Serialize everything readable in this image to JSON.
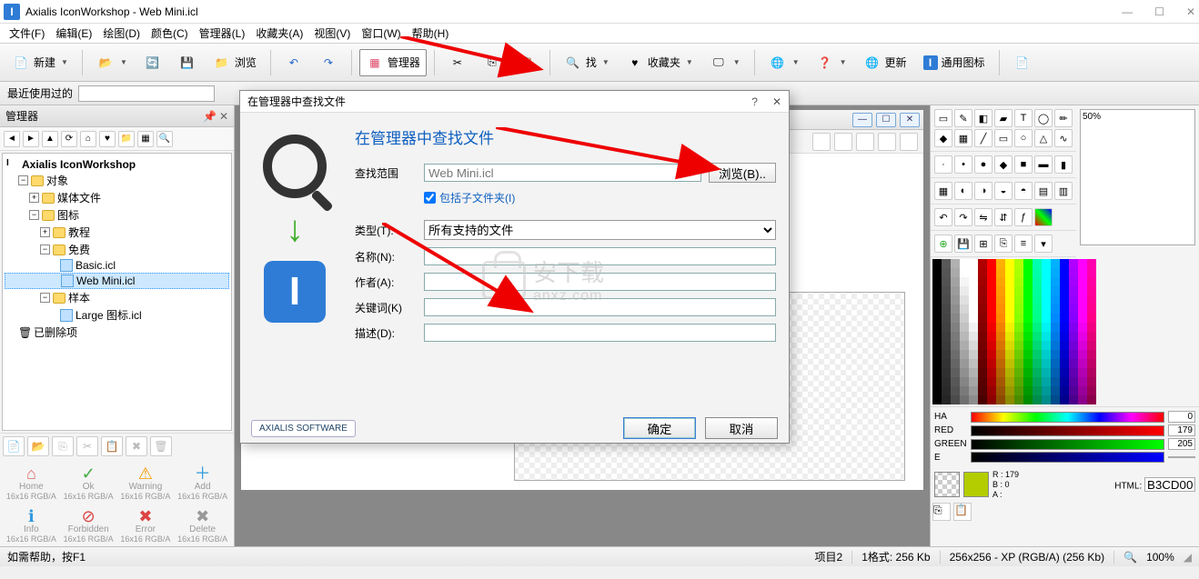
{
  "title": "Axialis IconWorkshop - Web Mini.icl",
  "menu": [
    "文件(F)",
    "编辑(E)",
    "绘图(D)",
    "颜色(C)",
    "管理器(L)",
    "收藏夹(A)",
    "视图(V)",
    "窗口(W)",
    "帮助(H)"
  ],
  "toolbar": {
    "new": "新建",
    "browse": "浏览",
    "manager": "管理器",
    "search": "找",
    "favorites": "收藏夹",
    "update": "更新",
    "general_icons": "通用图标"
  },
  "recent_label": "最近使用过的",
  "sidebar": {
    "header": "管理器",
    "root": "Axialis IconWorkshop",
    "items": [
      "对象",
      "媒体文件",
      "图标",
      "教程",
      "免费",
      "Basic.icl",
      "Web Mini.icl",
      "样本",
      "Large 图标.icl",
      "已删除项"
    ]
  },
  "icon_grid": [
    {
      "sym": "⌂",
      "name": "Home",
      "meta": "16x16 RGB/A",
      "color": "#d66"
    },
    {
      "sym": "✓",
      "name": "Ok",
      "meta": "16x16 RGB/A",
      "color": "#4a4"
    },
    {
      "sym": "⚠",
      "name": "Warning",
      "meta": "16x16 RGB/A",
      "color": "#e90"
    },
    {
      "sym": "＋",
      "name": "Add",
      "meta": "16x16 RGB/A",
      "color": "#39d"
    },
    {
      "sym": "ℹ",
      "name": "Info",
      "meta": "16x16 RGB/A",
      "color": "#39d"
    },
    {
      "sym": "⊘",
      "name": "Forbidden",
      "meta": "16x16 RGB/A",
      "color": "#d44"
    },
    {
      "sym": "✖",
      "name": "Error",
      "meta": "16x16 RGB/A",
      "color": "#d44"
    },
    {
      "sym": "✖",
      "name": "Delete",
      "meta": "16x16 RGB/A",
      "color": "#999"
    }
  ],
  "dialog": {
    "title": "在管理器中查找文件",
    "heading": "在管理器中查找文件",
    "scope_label": "查找范围",
    "scope_value": "Web Mini.icl",
    "browse_btn": "浏览(B)..",
    "include_sub": "包括子文件夹(I)",
    "type_label": "类型(T):",
    "type_value": "所有支持的文件",
    "name_label": "名称(N):",
    "author_label": "作者(A):",
    "keywords_label": "关键词(K)",
    "desc_label": "描述(D):",
    "ok": "确定",
    "cancel": "取消",
    "axialis": "AXIALIS SOFTWARE"
  },
  "color": {
    "ha": "HA",
    "ha_val": "0",
    "red": "RED",
    "red_val": "179",
    "green": "GREEN",
    "green_val": "205",
    "e": "E",
    "r": "R :",
    "r_val": "179",
    "b": "B :",
    "b_val": "0",
    "a": "A :",
    "html_label": "HTML:",
    "html_val": "B3CD00"
  },
  "status": {
    "help": "如需帮助，按F1",
    "project": "项目2",
    "format": "1格式:   256 Kb",
    "dims": "256x256 - XP (RGB/A) (256 Kb)",
    "zoom": "100%"
  },
  "zoom_panel": "50%",
  "watermark": "安下载 anxz.com"
}
